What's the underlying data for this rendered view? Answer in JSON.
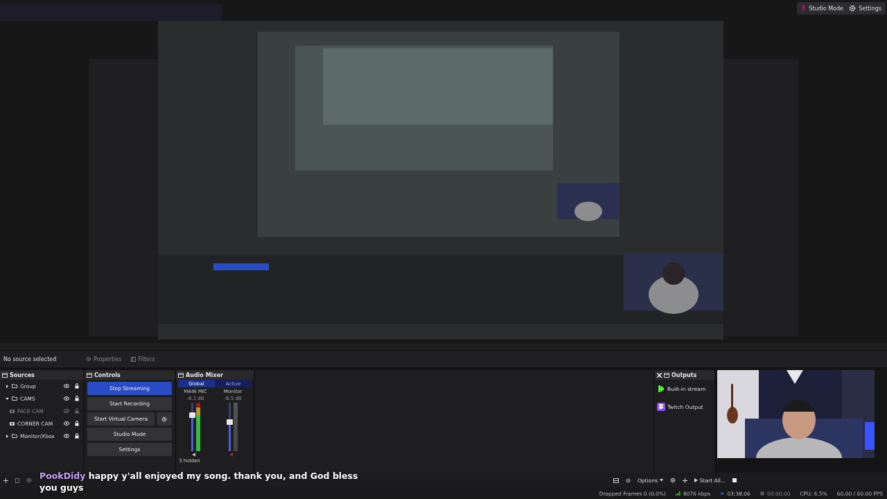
{
  "top_buttons": [
    {
      "label": "Studio Mode",
      "kind": "mic"
    },
    {
      "label": "Settings",
      "kind": "gear"
    }
  ],
  "context_bar": {
    "status": "No source selected",
    "buttons": [
      {
        "label": "Properties",
        "kind": "gear"
      },
      {
        "label": "Filters",
        "kind": "filter"
      }
    ]
  },
  "sources": {
    "title": "Sources",
    "items": [
      {
        "name": "Group",
        "kind": "folder",
        "expanded": false,
        "visible": true,
        "locked": true
      },
      {
        "name": "CAMS",
        "kind": "folder",
        "expanded": true,
        "visible": true,
        "locked": true,
        "children": [
          {
            "name": "FACE CAM",
            "kind": "camera",
            "visible": false,
            "locked": false
          },
          {
            "name": "CORNER CAM",
            "kind": "camera",
            "visible": true,
            "locked": true
          }
        ]
      },
      {
        "name": "Monitor/Xbox",
        "kind": "folder",
        "expanded": false,
        "visible": true,
        "locked": true
      }
    ]
  },
  "controls": {
    "title": "Controls",
    "buttons": [
      {
        "label": "Stop Streaming",
        "selected": true,
        "has_settings": false
      },
      {
        "label": "Start Recording",
        "selected": false,
        "has_settings": false
      },
      {
        "label": "Start Virtual Camera",
        "selected": false,
        "has_settings": true
      },
      {
        "label": "Studio Mode",
        "selected": false,
        "has_settings": false
      },
      {
        "label": "Settings",
        "selected": false,
        "has_settings": false
      }
    ]
  },
  "audio_mixer": {
    "title": "Audio Mixer",
    "tabs": [
      {
        "label": "Global",
        "selected": true
      },
      {
        "label": "Active",
        "selected": false
      }
    ],
    "channels": [
      {
        "name": "MAIN MIC",
        "reading": "-6.1 dB",
        "level": 0.75,
        "muted": false
      },
      {
        "name": "Monitor",
        "reading": "-8.5 dB",
        "level": 0.6,
        "muted": true
      }
    ],
    "hidden_note": "3 hidden"
  },
  "outputs": {
    "title": "Outputs",
    "items": [
      {
        "name": "Built-in stream",
        "kind": "kick"
      },
      {
        "name": "Twitch Output",
        "kind": "twitch"
      }
    ]
  },
  "bottom_toolbar": {
    "options": "Options",
    "start_all": "Start All..."
  },
  "status_bar": {
    "dropped_frames": "Dropped Frames 0 (0.0%)",
    "bitrate": "8076 kbps",
    "stream_time": "03:38:06",
    "record_time": "00:00:00",
    "cpu": "CPU: 6.5%",
    "fps": "60.00 / 60.00 FPS"
  },
  "caption": {
    "user": "PookDidy",
    "message": "happy y'all enjoyed my song. thank you, and God bless you guys"
  }
}
